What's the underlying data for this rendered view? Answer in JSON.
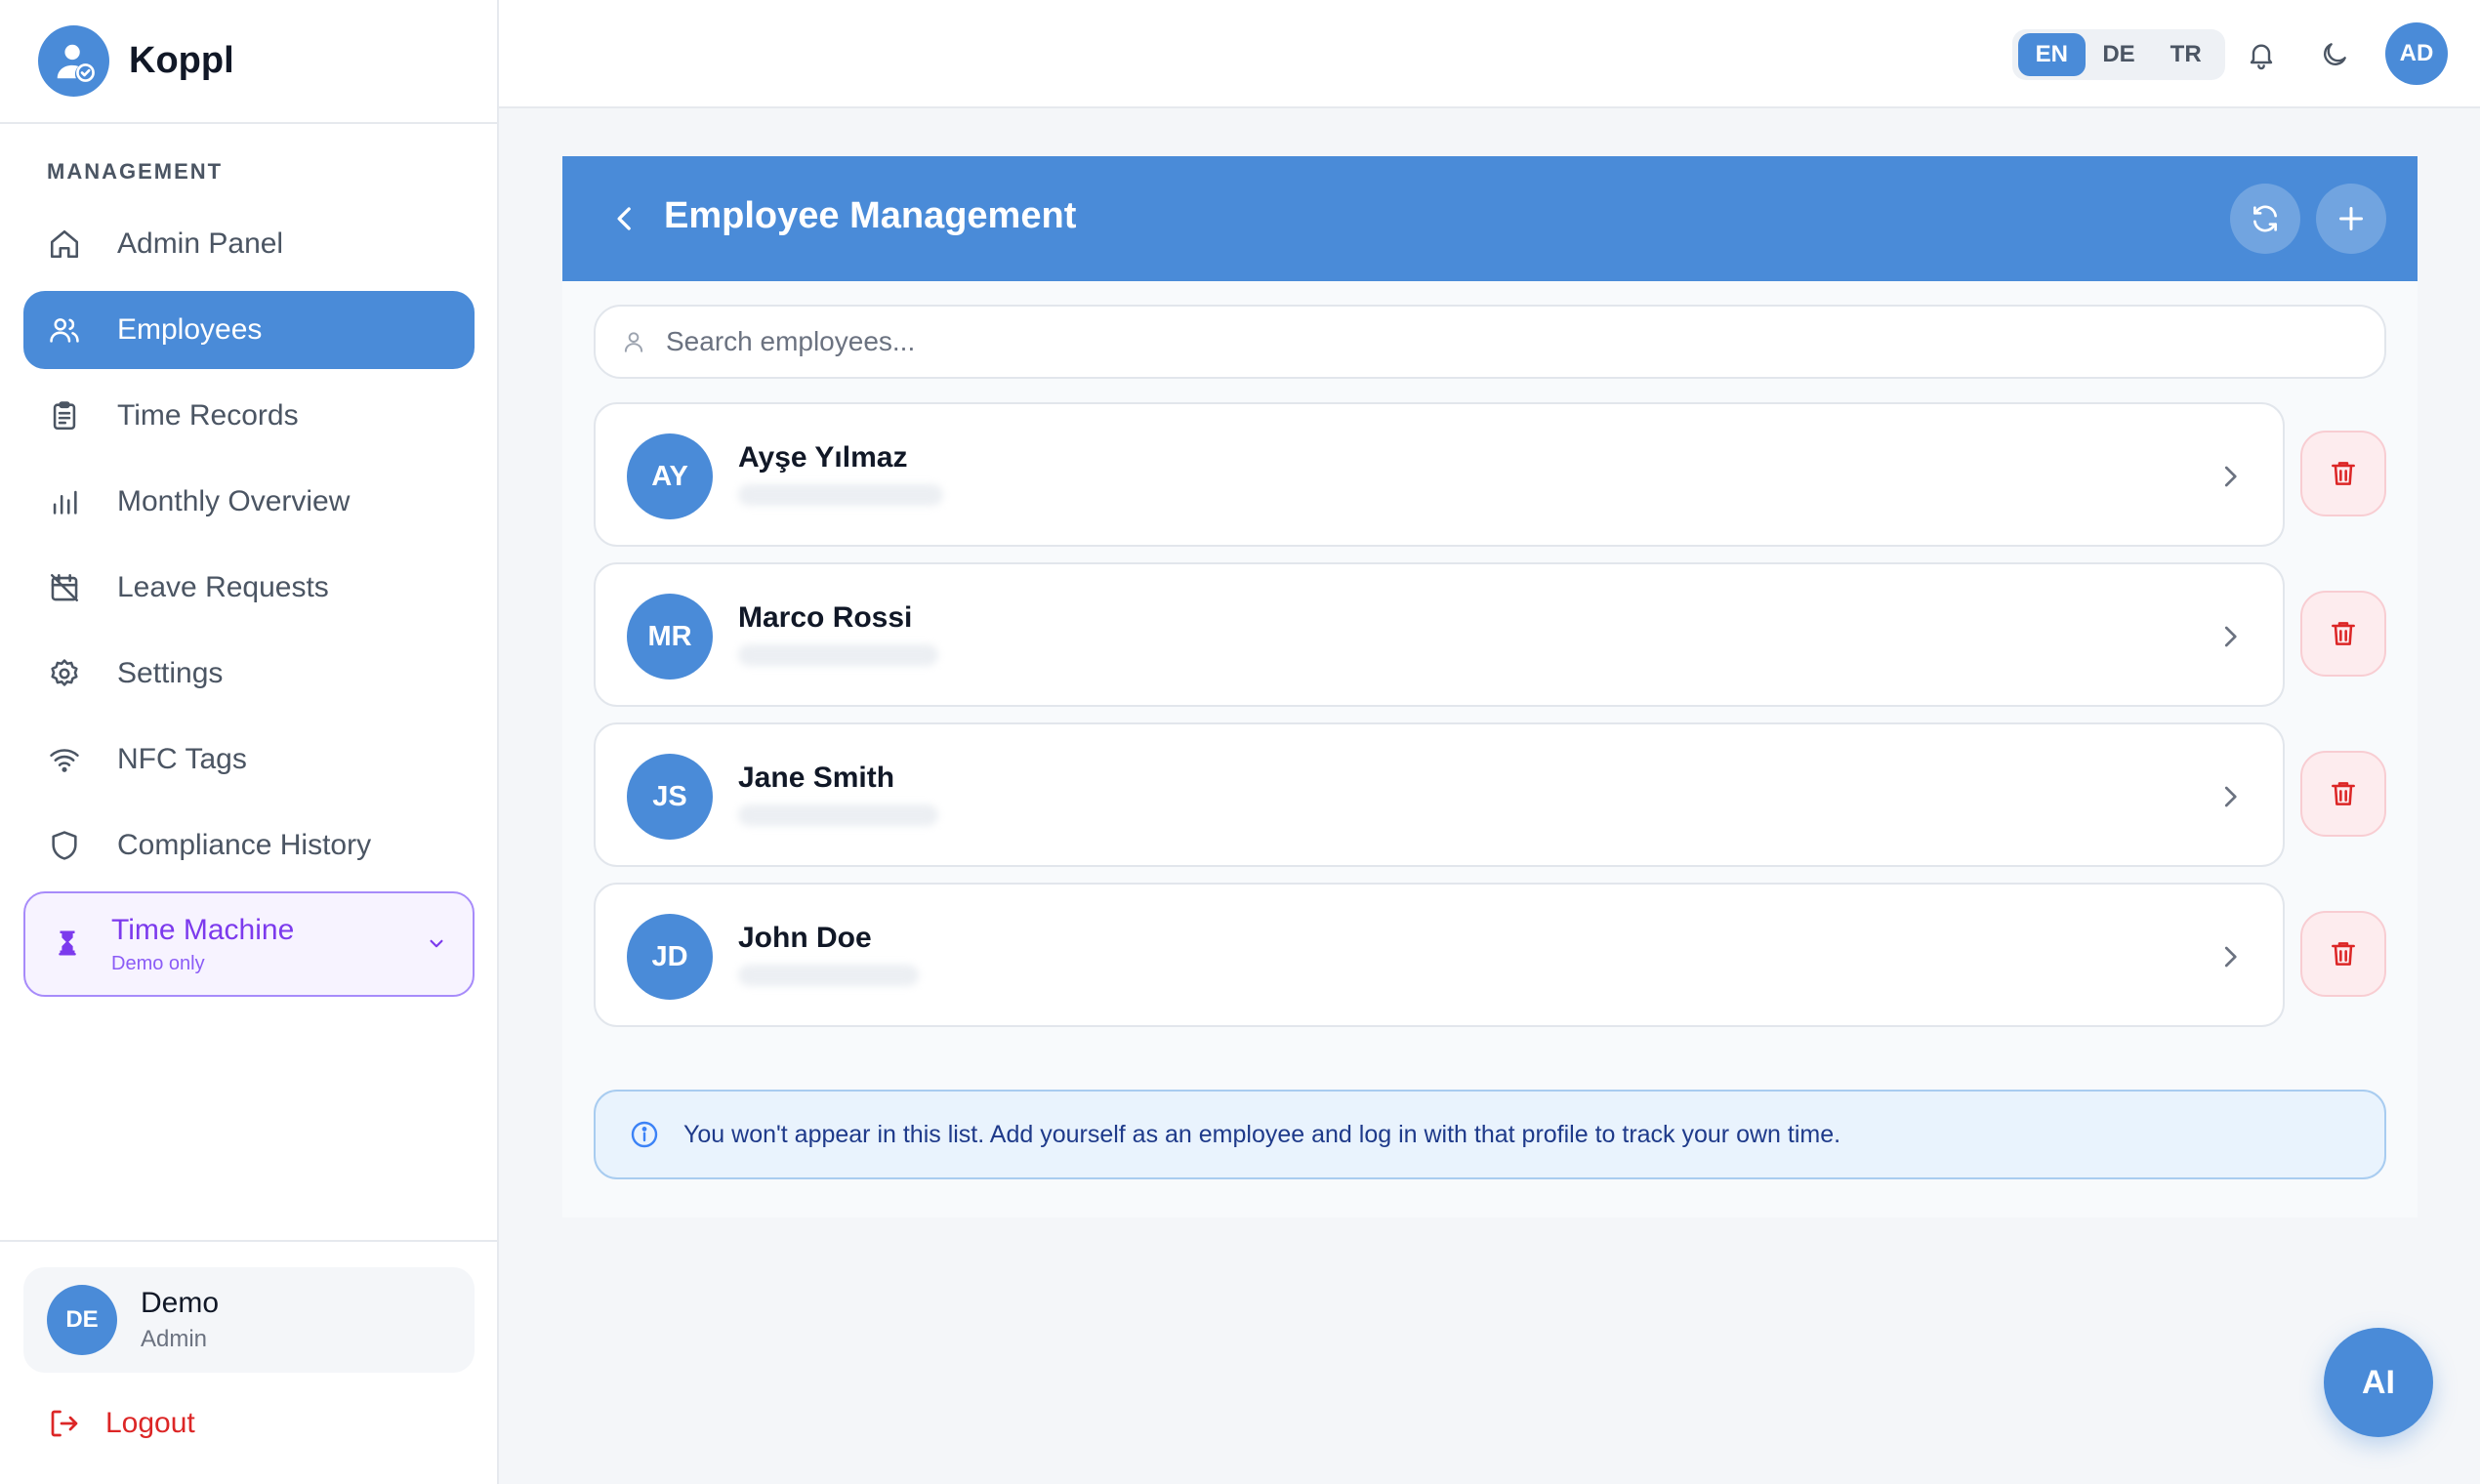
{
  "brand": {
    "name": "Koppl",
    "icon": "user-check-icon"
  },
  "sidebar": {
    "section_label": "MANAGEMENT",
    "items": [
      {
        "label": "Admin Panel",
        "icon": "home-icon",
        "active": false
      },
      {
        "label": "Employees",
        "icon": "users-icon",
        "active": true
      },
      {
        "label": "Time Records",
        "icon": "clipboard-list-icon",
        "active": false
      },
      {
        "label": "Monthly Overview",
        "icon": "bar-chart-icon",
        "active": false
      },
      {
        "label": "Leave Requests",
        "icon": "calendar-off-icon",
        "active": false
      },
      {
        "label": "Settings",
        "icon": "gear-icon",
        "active": false
      },
      {
        "label": "NFC Tags",
        "icon": "wifi-icon",
        "active": false
      },
      {
        "label": "Compliance History",
        "icon": "shield-icon",
        "active": false
      }
    ],
    "time_machine": {
      "title": "Time Machine",
      "subtitle": "Demo only",
      "icon": "hourglass-icon"
    },
    "user": {
      "initials": "DE",
      "name": "Demo",
      "role": "Admin"
    },
    "logout_label": "Logout"
  },
  "topbar": {
    "languages": [
      "EN",
      "DE",
      "TR"
    ],
    "active_language": "EN",
    "user_initials": "AD"
  },
  "panel": {
    "title": "Employee Management",
    "search_placeholder": "Search employees...",
    "employees": [
      {
        "initials": "AY",
        "name": "Ayşe Yılmaz"
      },
      {
        "initials": "MR",
        "name": "Marco Rossi"
      },
      {
        "initials": "JS",
        "name": "Jane Smith"
      },
      {
        "initials": "JD",
        "name": "John Doe"
      }
    ],
    "info_text": "You won't appear in this list. Add yourself as an employee and log in with that profile to track your own time."
  },
  "ai_button": "AI",
  "colors": {
    "accent": "#4a8bd8",
    "danger": "#dc2626",
    "purple": "#7c3aed",
    "info_bg": "#e9f3fd"
  }
}
